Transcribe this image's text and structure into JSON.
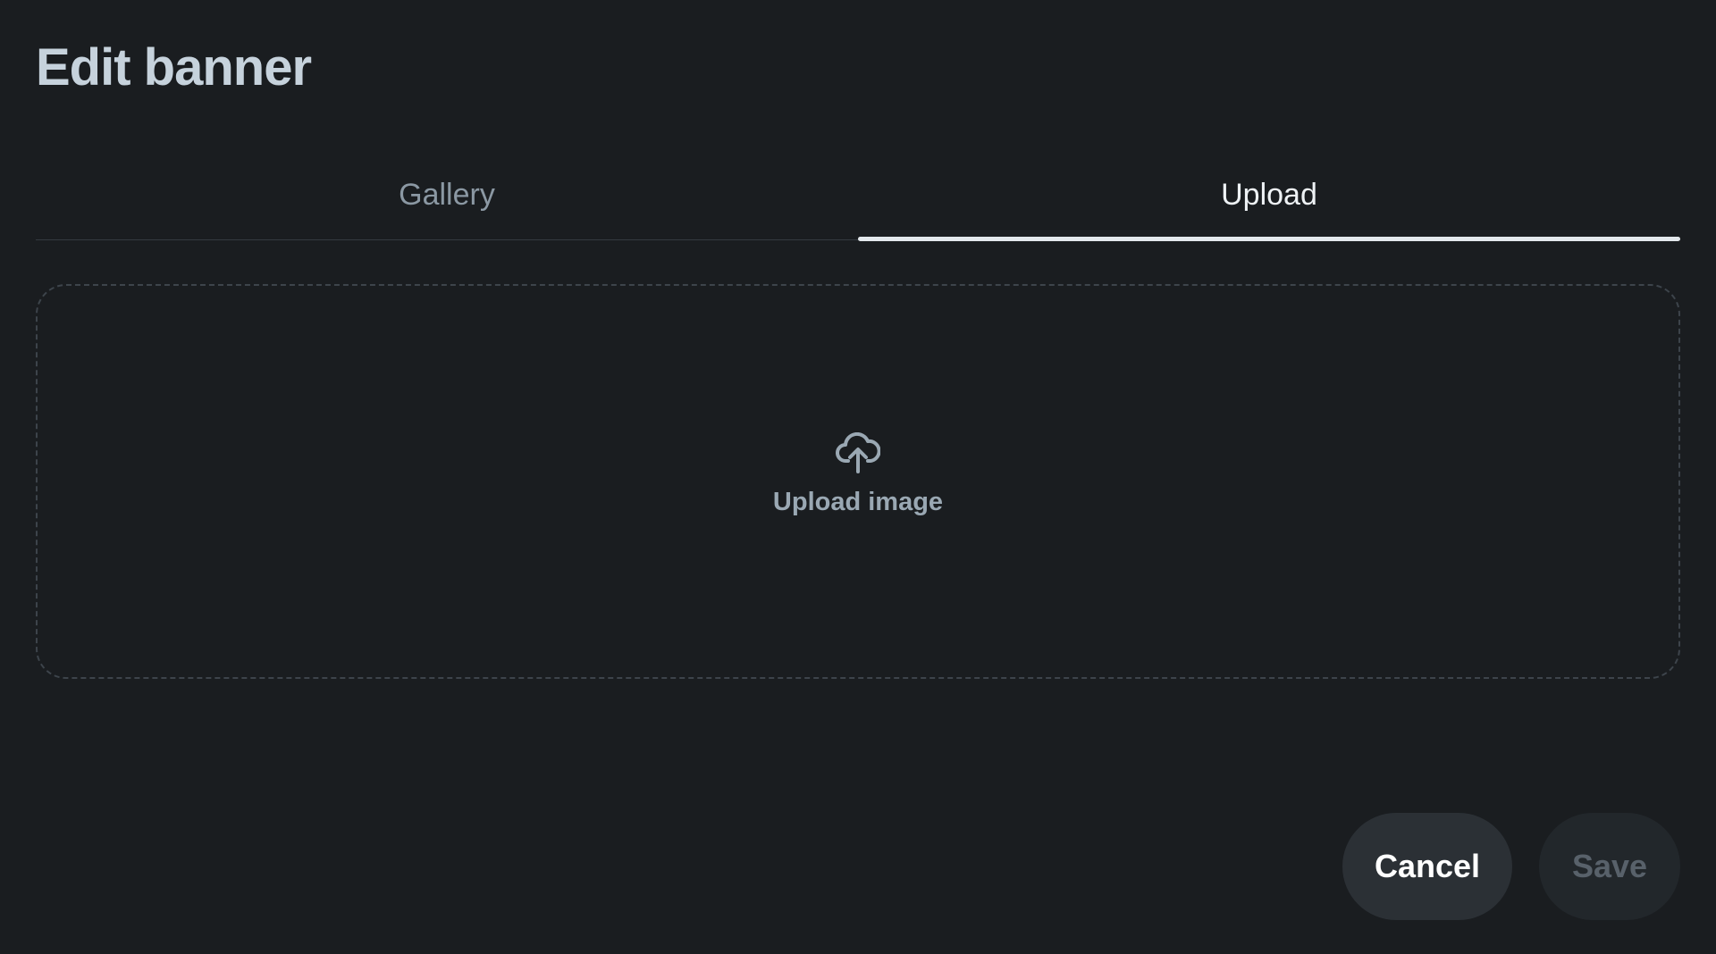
{
  "dialog": {
    "title": "Edit banner"
  },
  "tabs": [
    {
      "label": "Gallery",
      "active": false
    },
    {
      "label": "Upload",
      "active": true
    }
  ],
  "dropzone": {
    "icon": "cloud-upload-icon",
    "label": "Upload image"
  },
  "actions": {
    "cancel_label": "Cancel",
    "save_label": "Save",
    "save_enabled": false
  },
  "colors": {
    "background": "#1a1d20",
    "title": "#c6d2dc",
    "tab_active": "#eef2f5",
    "tab_inactive": "#8b98a3",
    "cancel_bg": "#2b3035",
    "save_bg_disabled": "#22272b",
    "save_text_disabled": "#58616a"
  }
}
